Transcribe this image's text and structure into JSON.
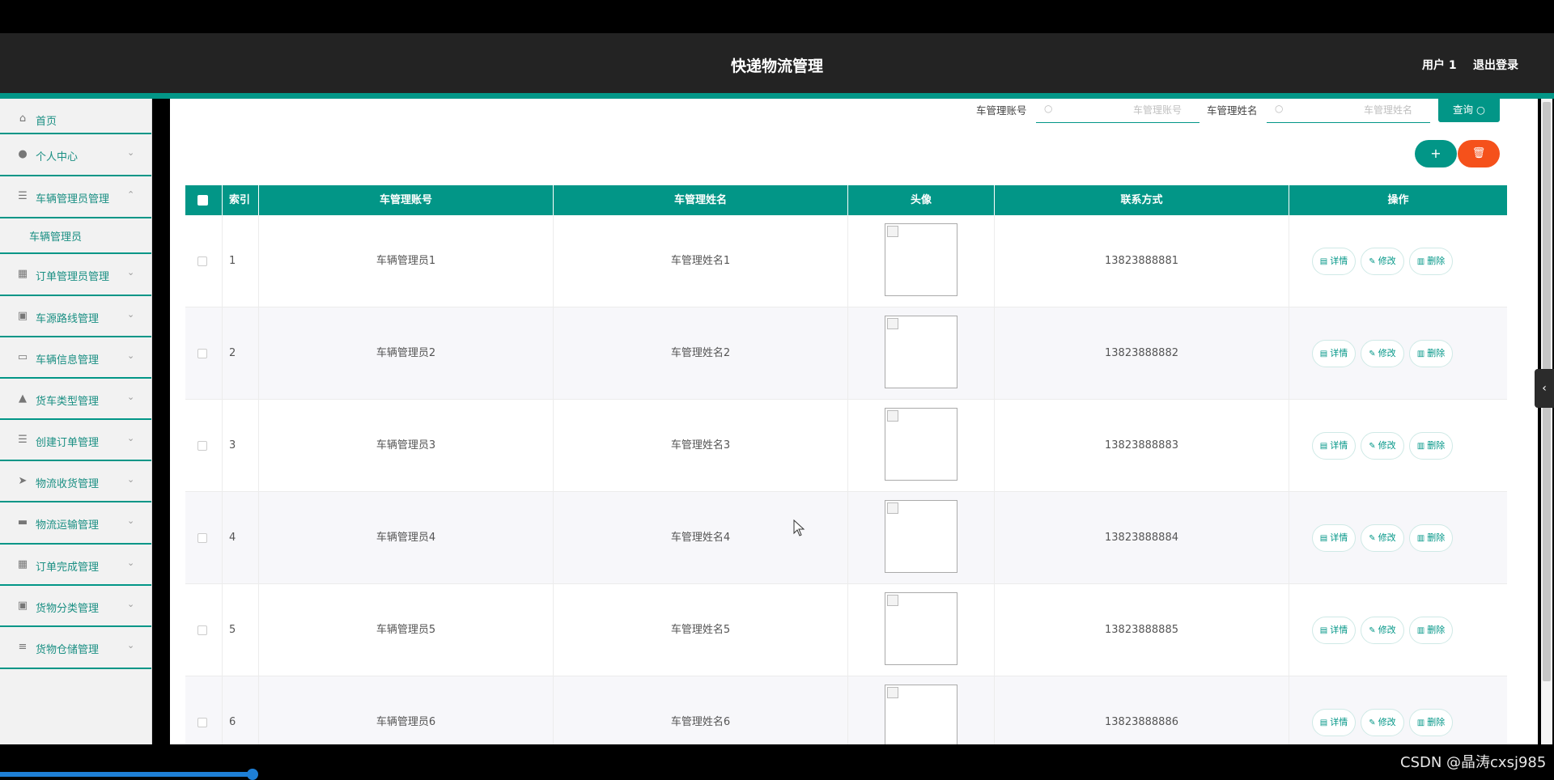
{
  "header": {
    "title": "快递物流管理",
    "user": "用户 1",
    "logout": "退出登录"
  },
  "sidebar": {
    "items": [
      {
        "label": "首页",
        "icon": "home-icon",
        "glyph": "⌂"
      },
      {
        "label": "个人中心",
        "icon": "user-icon",
        "glyph": "●"
      },
      {
        "label": "车辆管理员管理",
        "icon": "list-icon",
        "glyph": "☰"
      },
      {
        "label": "订单管理员管理",
        "icon": "grid-icon",
        "glyph": "▦"
      },
      {
        "label": "车源路线管理",
        "icon": "clipboard-icon",
        "glyph": "▣"
      },
      {
        "label": "车辆信息管理",
        "icon": "card-icon",
        "glyph": "▭"
      },
      {
        "label": "货车类型管理",
        "icon": "person-icon",
        "glyph": "▲"
      },
      {
        "label": "创建订单管理",
        "icon": "menu-icon",
        "glyph": "☰"
      },
      {
        "label": "物流收货管理",
        "icon": "send-icon",
        "glyph": "➤"
      },
      {
        "label": "物流运输管理",
        "icon": "truck-icon",
        "glyph": "▬"
      },
      {
        "label": "订单完成管理",
        "icon": "apps-icon",
        "glyph": "▦"
      },
      {
        "label": "货物分类管理",
        "icon": "checklist-icon",
        "glyph": "▣"
      },
      {
        "label": "货物仓储管理",
        "icon": "sliders-icon",
        "glyph": "≡"
      }
    ],
    "subitem": "车辆管理员"
  },
  "search": {
    "account_label": "车管理账号",
    "account_placeholder": "车管理账号",
    "name_label": "车管理姓名",
    "name_placeholder": "车管理姓名",
    "query_label": "查询"
  },
  "actions": {
    "add": "+",
    "delete": "🗑"
  },
  "table": {
    "headers": [
      "索引",
      "车管理账号",
      "车管理姓名",
      "头像",
      "联系方式",
      "操作"
    ],
    "rows": [
      {
        "index": "1",
        "account": "车辆管理员1",
        "name": "车管理姓名1",
        "phone": "13823888881"
      },
      {
        "index": "2",
        "account": "车辆管理员2",
        "name": "车管理姓名2",
        "phone": "13823888882"
      },
      {
        "index": "3",
        "account": "车辆管理员3",
        "name": "车管理姓名3",
        "phone": "13823888883"
      },
      {
        "index": "4",
        "account": "车辆管理员4",
        "name": "车管理姓名4",
        "phone": "13823888884"
      },
      {
        "index": "5",
        "account": "车辆管理员5",
        "name": "车管理姓名5",
        "phone": "13823888885"
      },
      {
        "index": "6",
        "account": "车辆管理员6",
        "name": "车管理姓名6",
        "phone": "13823888886"
      }
    ],
    "op_labels": {
      "detail": "详情",
      "edit": "修改",
      "remove": "删除"
    }
  },
  "watermark": "CSDN @晶涛cxsj985",
  "colors": {
    "accent": "#029687",
    "danger": "#f5511b",
    "header_bg": "#232323"
  }
}
